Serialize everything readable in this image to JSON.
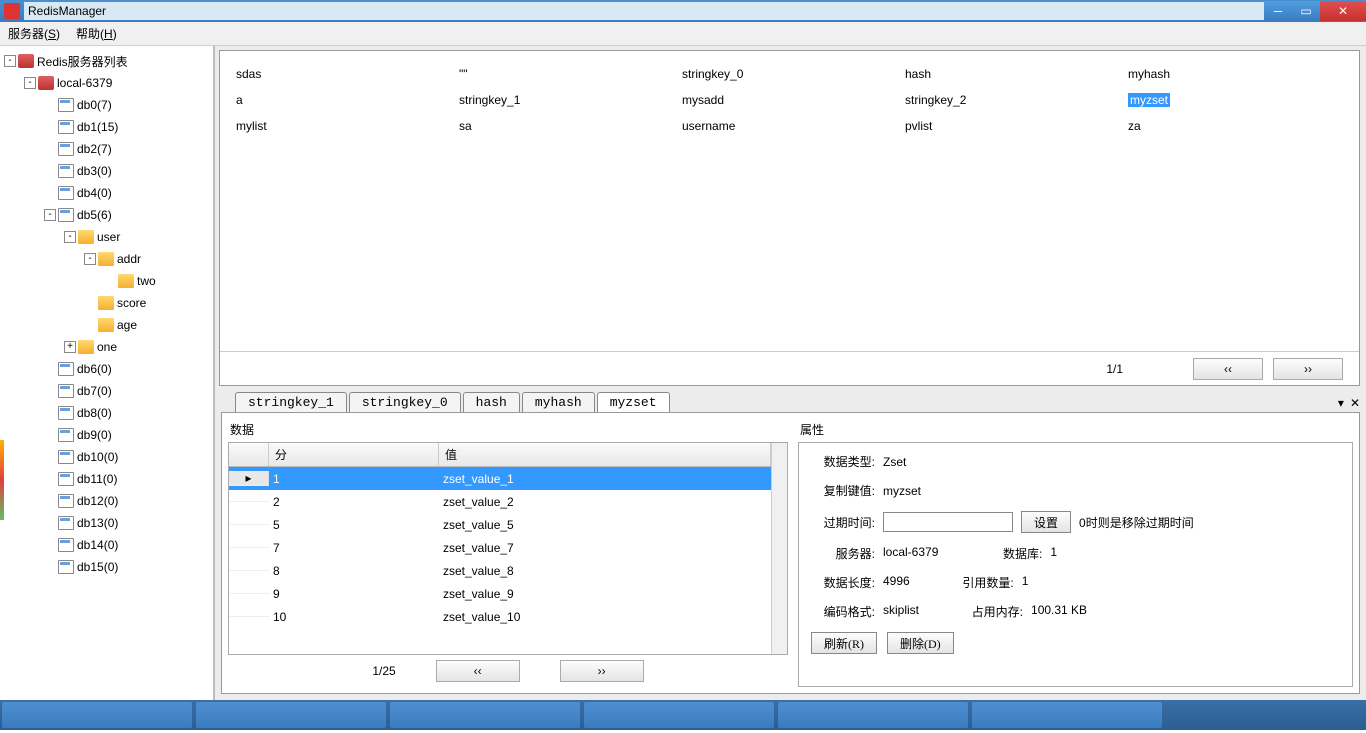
{
  "window": {
    "title": "RedisManager"
  },
  "menu": {
    "server": "服务器(",
    "server_u": "S",
    "server_end": ")",
    "help": "帮助(",
    "help_u": "H",
    "help_end": ")"
  },
  "tree": {
    "root": "Redis服务器列表",
    "conn": "local-6379",
    "dbs": [
      "db0(7)",
      "db1(15)",
      "db2(7)",
      "db3(0)",
      "db4(0)",
      "db5(6)",
      "db6(0)",
      "db7(0)",
      "db8(0)",
      "db9(0)",
      "db10(0)",
      "db11(0)",
      "db12(0)",
      "db13(0)",
      "db14(0)",
      "db15(0)"
    ],
    "db5_children": {
      "user": "user",
      "addr": "addr",
      "two": "two",
      "score": "score",
      "age": "age",
      "one": "one"
    }
  },
  "keys": {
    "rows": [
      [
        "sdas",
        "\"\"",
        "stringkey_0",
        "hash",
        "myhash"
      ],
      [
        "a",
        "stringkey_1",
        "mysadd",
        "stringkey_2",
        "myzset"
      ],
      [
        "mylist",
        "sa",
        "username",
        "pvlist",
        "za"
      ]
    ],
    "selected": [
      1,
      4
    ],
    "pager": "1/1"
  },
  "tabs": {
    "items": [
      "stringkey_1",
      "stringkey_0",
      "hash",
      "myhash",
      "myzset"
    ],
    "active": 4
  },
  "data_section_label": "数据",
  "props_section_label": "属性",
  "zset": {
    "headers": {
      "score": "分",
      "value": "值"
    },
    "rows": [
      {
        "s": "1",
        "v": "zset_value_1"
      },
      {
        "s": "2",
        "v": "zset_value_2"
      },
      {
        "s": "5",
        "v": "zset_value_5"
      },
      {
        "s": "7",
        "v": "zset_value_7"
      },
      {
        "s": "8",
        "v": "zset_value_8"
      },
      {
        "s": "9",
        "v": "zset_value_9"
      },
      {
        "s": "10",
        "v": "zset_value_10"
      }
    ],
    "selected": 0,
    "pager": "1/25"
  },
  "props": {
    "type_label": "数据类型:",
    "type": "Zset",
    "copykey_label": "复制键值:",
    "copykey": "myzset",
    "expire_label": "过期时间:",
    "set_btn": "设置",
    "expire_hint": "0时则是移除过期时间",
    "server_label": "服务器:",
    "server": "local-6379",
    "db_label": "数据库:",
    "db": "1",
    "length_label": "数据长度:",
    "length": "4996",
    "refcount_label": "引用数量:",
    "refcount": "1",
    "encoding_label": "编码格式:",
    "encoding": "skiplist",
    "mem_label": "占用内存:",
    "mem": "100.31 KB",
    "refresh_btn": "刷新(R)",
    "delete_btn": "删除(D)"
  },
  "nav": {
    "prev": "‹‹",
    "next": "››"
  }
}
